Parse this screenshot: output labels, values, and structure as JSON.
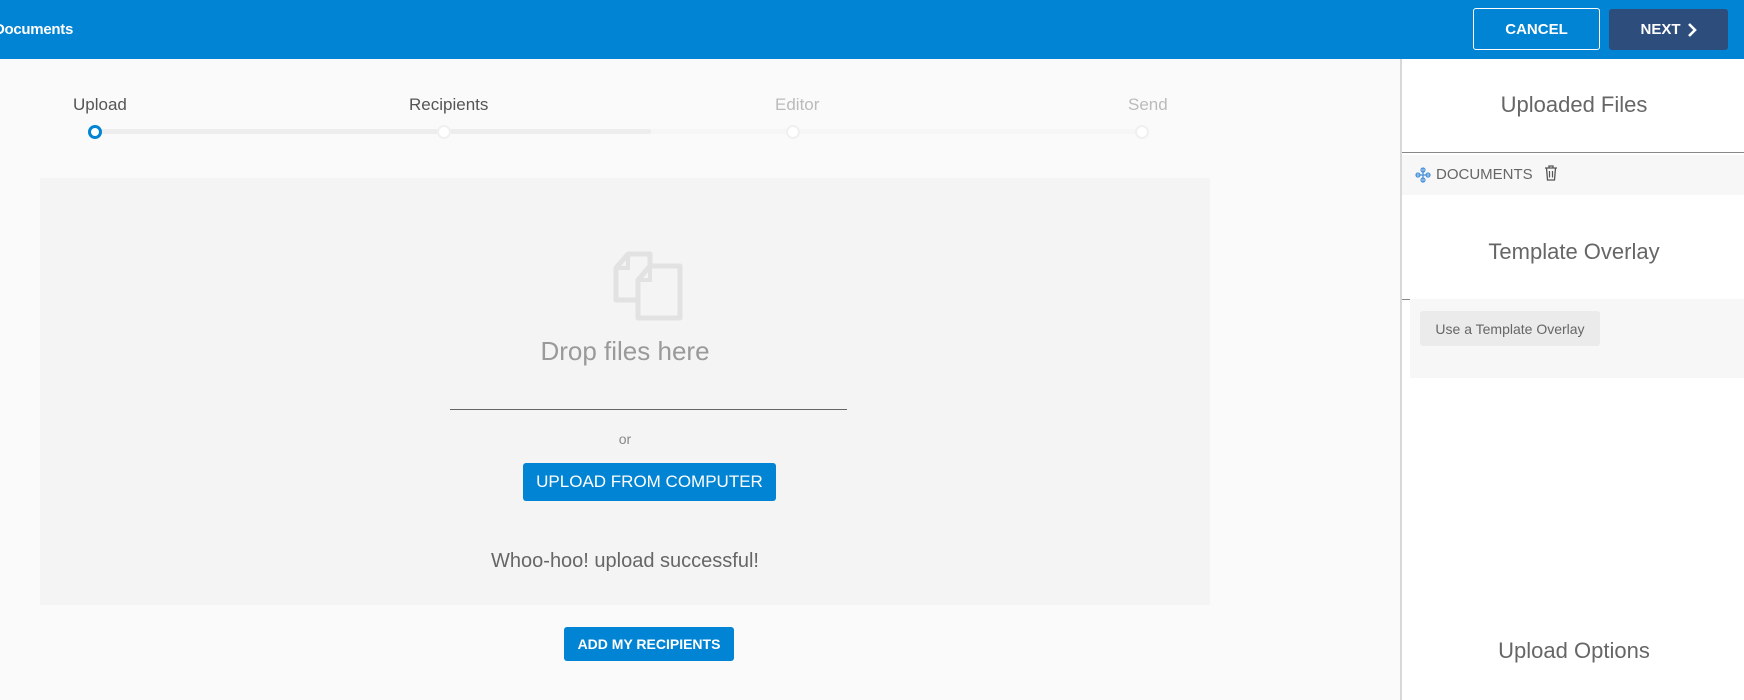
{
  "header": {
    "title": "Documents",
    "cancel_label": "CANCEL",
    "next_label": "NEXT"
  },
  "stepper": {
    "steps": [
      {
        "label": "Upload",
        "state": "current"
      },
      {
        "label": "Recipients",
        "state": "pending"
      },
      {
        "label": "Editor",
        "state": "disabled"
      },
      {
        "label": "Send",
        "state": "disabled"
      }
    ]
  },
  "dropzone": {
    "icon": "documents-icon",
    "drop_text": "Drop files here",
    "or_text": "or",
    "upload_button": "UPLOAD FROM COMPUTER",
    "status_text": "Whoo-hoo! upload successful!"
  },
  "add_recipients_button": "ADD MY RECIPIENTS",
  "sidebar": {
    "uploaded_files_title": "Uploaded Files",
    "documents_label": "DOCUMENTS",
    "template_overlay_title": "Template Overlay",
    "template_button": "Use a Template Overlay",
    "upload_options_title": "Upload Options"
  },
  "colors": {
    "header_bg": "#0284d4",
    "next_bg": "#2d4e7c",
    "primary_button": "#0284d4"
  }
}
